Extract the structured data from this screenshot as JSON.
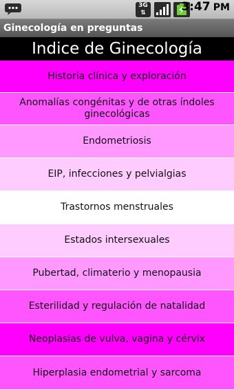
{
  "status_bar": {
    "time": "3:47",
    "time_suffix": "PM",
    "network_label": "3G",
    "icons": [
      "notification-icon",
      "network-3g-icon",
      "signal-icon",
      "battery-charging-icon"
    ]
  },
  "app": {
    "title": "Ginecología en preguntas"
  },
  "header": {
    "title": "Indice de Ginecología"
  },
  "colors": {
    "magenta": "#ff00ff",
    "pink_strong": "#ff55ff",
    "pink_medium": "#ff99ff",
    "pink_light": "#ffccff",
    "white": "#ffffff"
  },
  "list": {
    "items": [
      {
        "label": "Historia clínica y exploración",
        "color": "#ff00ff"
      },
      {
        "label": "Anomalías congénitas y de otras índoles ginecológicas",
        "color": "#ff55ff"
      },
      {
        "label": "Endometriosis",
        "color": "#ff99ff"
      },
      {
        "label": "EIP, infecciones y pelvialgias",
        "color": "#ffccff"
      },
      {
        "label": "Trastornos menstruales",
        "color": "#ffffff"
      },
      {
        "label": "Estados intersexuales",
        "color": "#ffccff"
      },
      {
        "label": "Pubertad, climaterio y menopausia",
        "color": "#ff99ff"
      },
      {
        "label": "Esterilidad y regulación de natalidad",
        "color": "#ff55ff"
      },
      {
        "label": "Neoplasias de vulva, vagina y cérvix",
        "color": "#ff00ff"
      },
      {
        "label": "Hiperplasia endometrial y sarcoma",
        "color": "#ff55ff"
      }
    ]
  }
}
